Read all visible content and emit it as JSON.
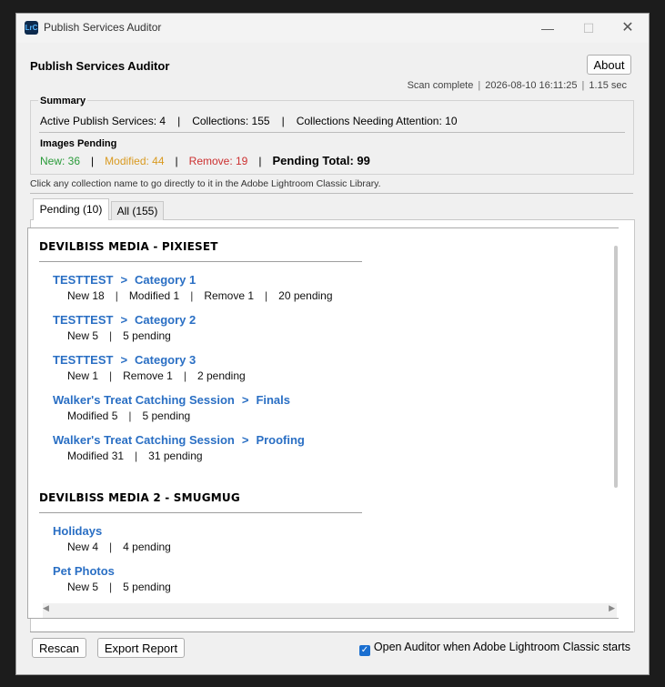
{
  "window": {
    "icon_text": "LrC",
    "title": "Publish Services Auditor",
    "min_glyph": "—",
    "max_glyph": "☐",
    "close_glyph": "✕"
  },
  "header": {
    "heading": "Publish Services Auditor",
    "about_label": "About",
    "status": {
      "scan": "Scan complete",
      "timestamp": "2026-08-10 16:11:25",
      "duration": "1.15 sec",
      "separator": "|"
    }
  },
  "summary": {
    "title": "Summary",
    "active_services": "Active Publish Services: 4",
    "collections": "Collections: 155",
    "needing_attention": "Collections Needing Attention: 10",
    "separator": "|",
    "images_pending_title": "Images Pending",
    "new": "New: 36",
    "modified": "Modified: 44",
    "remove": "Remove: 19",
    "total": "Pending Total: 99",
    "colors": {
      "new": "#2a9b3a",
      "modified": "#d99a20",
      "remove": "#cc3030"
    }
  },
  "hint": "Click any collection name to go directly to it in the Adobe Lightroom Classic Library.",
  "tabs": [
    {
      "label": "Pending (10)",
      "active": true
    },
    {
      "label": "All (155)",
      "active": false
    }
  ],
  "services": [
    {
      "name": "DEVILBISS MEDIA - PIXIESET",
      "collections": [
        {
          "set": "TESTTEST",
          "arrow": ">",
          "name": "Category 1",
          "details": [
            "New 18",
            "Modified 1",
            "Remove 1",
            "20 pending"
          ]
        },
        {
          "set": "TESTTEST",
          "arrow": ">",
          "name": "Category 2",
          "details": [
            "New 5",
            "5 pending"
          ]
        },
        {
          "set": "TESTTEST",
          "arrow": ">",
          "name": "Category 3",
          "details": [
            "New 1",
            "Remove 1",
            "2 pending"
          ]
        },
        {
          "set": "Walker's Treat Catching Session",
          "arrow": ">",
          "name": "Finals",
          "details": [
            "Modified 5",
            "5 pending"
          ]
        },
        {
          "set": "Walker's Treat Catching Session",
          "arrow": ">",
          "name": "Proofing",
          "details": [
            "Modified 31",
            "31 pending"
          ]
        }
      ]
    },
    {
      "name": "DEVILBISS MEDIA 2 - SMUGMUG",
      "collections": [
        {
          "name": "Holidays",
          "details": [
            "New 4",
            "4 pending"
          ]
        },
        {
          "name": "Pet Photos",
          "details": [
            "New 5",
            "5 pending"
          ]
        }
      ]
    }
  ],
  "link_color": "#2a6fc4",
  "footer": {
    "rescan_label": "Rescan",
    "export_label": "Export Report",
    "checkbox_label": "Open Auditor when Adobe Lightroom Classic starts",
    "checkbox_checked": true,
    "check_glyph": "✓"
  },
  "scroll": {
    "left_arrow": "◀",
    "right_arrow": "▶"
  }
}
